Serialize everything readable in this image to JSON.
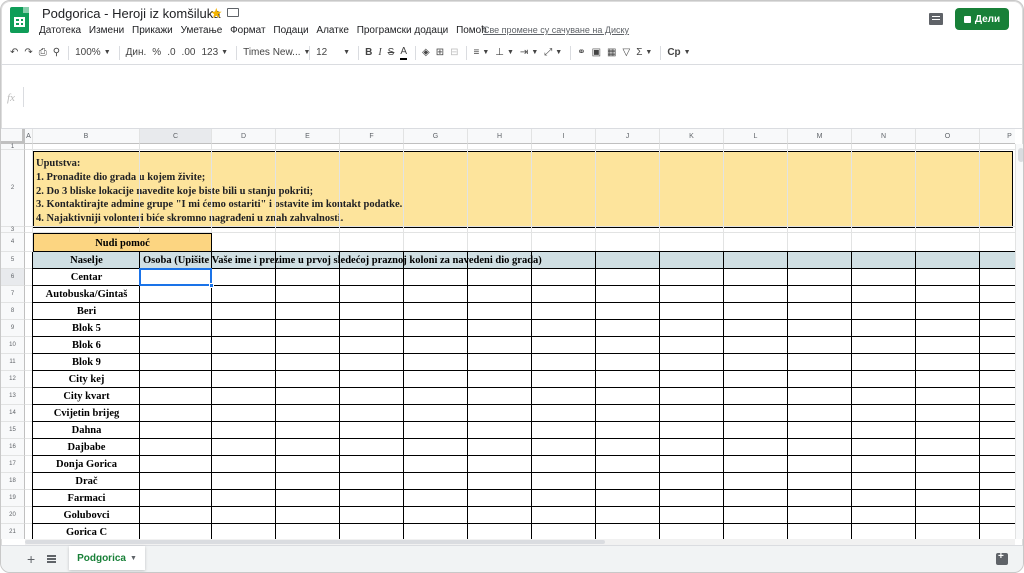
{
  "app": {
    "doc_title": "Podgorica - Heroji iz komšiluka",
    "share_label": "Дели",
    "save_status": "Све промене су сачуване на Диску"
  },
  "menu": [
    "Датотека",
    "Измени",
    "Прикажи",
    "Уметање",
    "Формат",
    "Подаци",
    "Алатке",
    "Програмски додаци",
    "Помоћ"
  ],
  "toolbar": {
    "zoom": "100%",
    "currency": "Дин.",
    "percent": "%",
    "decimal_less": ".0",
    "decimal_more": ".00",
    "number_format": "123",
    "font_family": "Times New...",
    "font_size": "12",
    "bold": "B",
    "italic": "I",
    "strike": "S",
    "text_color": "A",
    "input_tools": "Ср"
  },
  "formula_bar": {
    "fx": "fx",
    "value": ""
  },
  "grid": {
    "columns": [
      "A",
      "B",
      "C",
      "D",
      "E",
      "F",
      "G",
      "H",
      "I",
      "J",
      "K",
      "L",
      "M",
      "N",
      "O",
      "P"
    ],
    "rows": [
      "1",
      "2",
      "3",
      "4",
      "5",
      "6",
      "7",
      "8",
      "9",
      "10",
      "11",
      "12",
      "13",
      "14",
      "15",
      "16",
      "17",
      "18",
      "19",
      "20",
      "21"
    ],
    "selected_cell": "C6"
  },
  "sheet": {
    "instructions": [
      "Uputstva:",
      "1. Pronađite dio grada u kojem živite;",
      "2. Do 3 bliske lokacije navedite koje biste bili u stanju pokriti;",
      "3. Kontaktirajte admine grupe \"I mi ćemo ostariti\" i ostavite im kontakt podatke.",
      "4. Najaktivniji volonteri biće skromno nagrađeni u znah zahvalnosti."
    ],
    "offer_help": "Nudi pomoć",
    "col_settlement": "Naselje",
    "col_person": "Osoba (Upišite Vaše ime i prezime u prvoj sledećoj praznoj koloni za navedeni dio grada)",
    "settlements": [
      "Centar",
      "Autobuska/Gintaš",
      "Beri",
      "Blok 5",
      "Blok 6",
      "Blok 9",
      "City kej",
      "City kvart",
      "Cvijetin brijeg",
      "Dahna",
      "Dajbabe",
      "Donja Gorica",
      "Drač",
      "Farmaci",
      "Golubovci",
      "Gorica C"
    ]
  },
  "tabs": {
    "active": "Podgorica"
  },
  "colors": {
    "instructions_bg": "#fde49c",
    "offer_help_bg": "#fcd581",
    "header_bg": "#d0dfe3",
    "selection": "#1a73e8",
    "share_button": "#188038"
  },
  "icons": [
    "sheets-logo-icon",
    "star-icon",
    "folder-icon",
    "comment-icon",
    "lock-icon",
    "undo-icon",
    "redo-icon",
    "print-icon",
    "paint-format-icon",
    "fill-color-icon",
    "borders-icon",
    "merge-icon",
    "align-left-icon",
    "valign-bottom-icon",
    "wrap-icon",
    "rotate-icon",
    "link-icon",
    "insert-comment-icon",
    "insert-chart-icon",
    "filter-icon",
    "sum-icon",
    "add-sheet-icon",
    "all-sheets-icon",
    "explore-icon"
  ]
}
